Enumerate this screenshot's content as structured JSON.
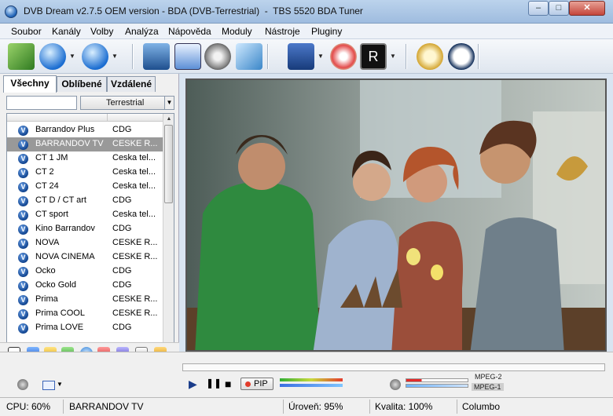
{
  "window": {
    "title": "DVB Dream v2.7.5 OEM version - BDA (DVB-Terrestrial)  -  TBS 5520 BDA Tuner",
    "min_glyph": "–",
    "max_glyph": "□",
    "close_glyph": "✕"
  },
  "menu": [
    "Soubor",
    "Kanály",
    "Volby",
    "Analýza",
    "Nápověda",
    "Moduly",
    "Nástroje",
    "Pluginy"
  ],
  "tabs": [
    {
      "label": "Všechny",
      "active": true
    },
    {
      "label": "Oblíbené",
      "active": false
    },
    {
      "label": "Vzdálené",
      "active": false
    }
  ],
  "filter": {
    "search_value": "",
    "select_value": "Terrestrial",
    "dropdown_glyph": "▼"
  },
  "channels": [
    {
      "name": "Barrandov Plus",
      "network": "CDG",
      "selected": false
    },
    {
      "name": "BARRANDOV TV",
      "network": "CESKE R...",
      "selected": true
    },
    {
      "name": "CT 1 JM",
      "network": "Ceska tel...",
      "selected": false
    },
    {
      "name": "CT 2",
      "network": "Ceska tel...",
      "selected": false
    },
    {
      "name": "CT 24",
      "network": "Ceska tel...",
      "selected": false
    },
    {
      "name": "CT D / CT art",
      "network": "CDG",
      "selected": false
    },
    {
      "name": "CT sport",
      "network": "Ceska tel...",
      "selected": false
    },
    {
      "name": "Kino Barrandov",
      "network": "CDG",
      "selected": false
    },
    {
      "name": "NOVA",
      "network": "CESKE R...",
      "selected": false
    },
    {
      "name": "NOVA CINEMA",
      "network": "CESKE R...",
      "selected": false
    },
    {
      "name": "Ocko",
      "network": "CDG",
      "selected": false
    },
    {
      "name": "Ocko Gold",
      "network": "CDG",
      "selected": false
    },
    {
      "name": "Prima",
      "network": "CESKE R...",
      "selected": false
    },
    {
      "name": "Prima COOL",
      "network": "CESKE R...",
      "selected": false
    },
    {
      "name": "Prima LOVE",
      "network": "CDG",
      "selected": false
    }
  ],
  "channel_icon_glyph": "V",
  "player": {
    "play": "▶",
    "pause": "❚❚",
    "stop": "■",
    "pip_label": "PIP",
    "codec_video": "MPEG-2",
    "codec_audio": "MPEG-1",
    "signal_level": 0.95,
    "quality_level": 1.0
  },
  "status": {
    "cpu": "CPU: 60%",
    "channel": "BARRANDOV TV",
    "level": "Úroveň: 95%",
    "quality": "Kvalita: 100%",
    "provider": "Columbo"
  },
  "scroll": {
    "up": "▲",
    "down": "▼"
  },
  "colors": {
    "selected_row": "#999999",
    "accent_blue": "#1a3c8a",
    "close_red": "#c4463b"
  }
}
